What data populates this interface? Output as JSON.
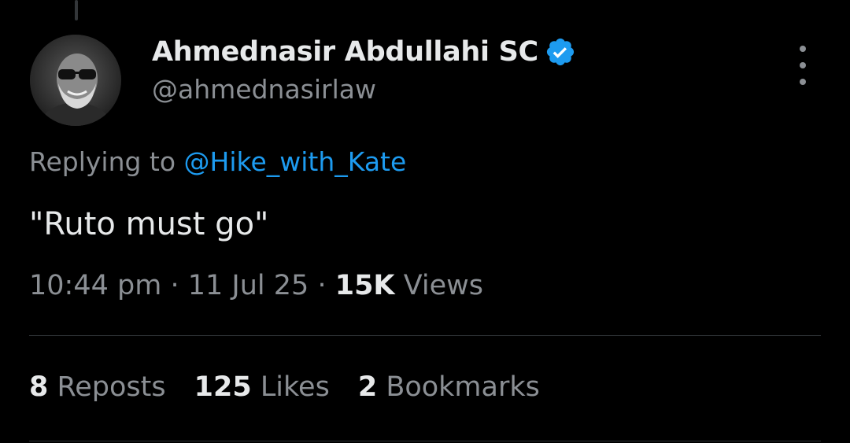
{
  "tweet": {
    "author": {
      "display_name": "Ahmednasir Abdullahi SC",
      "handle": "@ahmednasirlaw",
      "verified": true,
      "avatar": "avatar-photo"
    },
    "replying_to": {
      "prefix": "Replying to",
      "mention": "@Hike_with_Kate"
    },
    "text": "\"Ruto must go\"",
    "meta": {
      "time": "10:44 pm",
      "separator": "·",
      "date": "11 Jul 25",
      "views_count": "15K",
      "views_label": "Views"
    },
    "stats": {
      "reposts_count": "8",
      "reposts_label": "Reposts",
      "likes_count": "125",
      "likes_label": "Likes",
      "bookmarks_count": "2",
      "bookmarks_label": "Bookmarks"
    }
  },
  "colors": {
    "background": "#000000",
    "text_primary": "#e7e9ea",
    "text_secondary": "#8b8f94",
    "accent": "#1d9bf0",
    "divider": "#2f3336"
  },
  "icons": {
    "verified": "verified-badge-icon",
    "more": "more-vertical-icon"
  }
}
